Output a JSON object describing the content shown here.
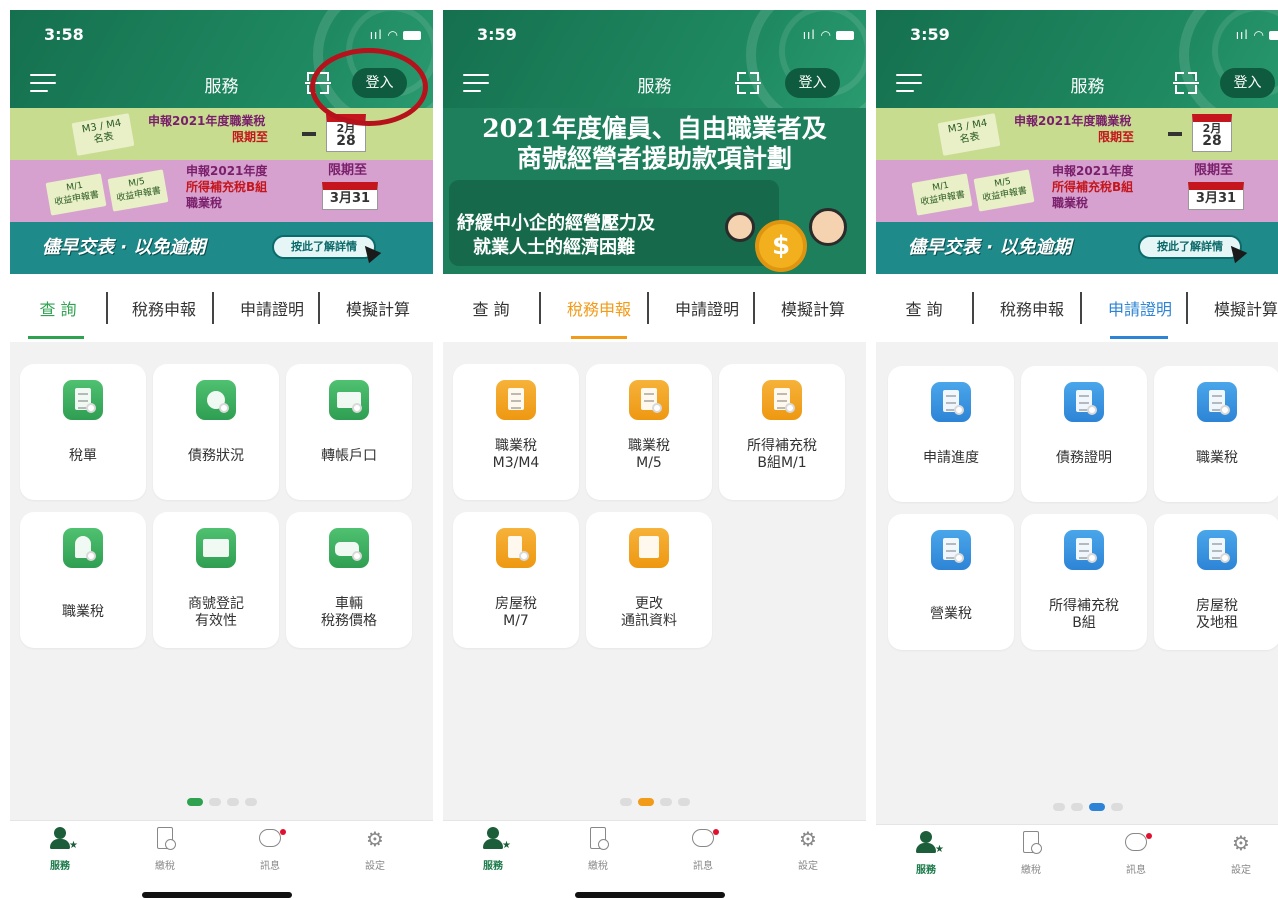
{
  "status": {
    "p1_time": "3:58",
    "p2_time": "3:59",
    "p3_time": "3:59"
  },
  "header": {
    "title": "服務",
    "login": "登入"
  },
  "banner": {
    "m34_tag": "M3 / M4\n名表",
    "b1_text1": "申報2021年度職業稅",
    "b1_text2": "限期至",
    "b1_date_month": "2月",
    "b1_date_day": "28",
    "m1_tag": "M/1\n收益申報書",
    "m5_tag": "M/5\n收益申報書",
    "b2_text1": "申報2021年度",
    "b2_text2": "所得補充稅B組",
    "b2_text3": "職業稅",
    "b2_deadline": "限期至",
    "b2_date": "3月31",
    "slogan": "儘早交表 · 以免逾期",
    "detail": "按此了解詳情"
  },
  "banner2": {
    "title_line1": "2021年度僱員、自由職業者及",
    "title_line2": "商號經營者援助款項計劃",
    "sub_line1": "紓緩中小企的經營壓力及",
    "sub_line2": "就業人士的經濟困難",
    "coin": "$"
  },
  "tabs": [
    "查 詢",
    "稅務申報",
    "申請證明",
    "模擬計算"
  ],
  "colors": {
    "green": "#2ea24f",
    "orange": "#f29b18",
    "blue": "#2d84d6",
    "header": "#15704f"
  },
  "p1_tiles": [
    "稅單",
    "債務狀況",
    "轉帳戶口",
    "職業稅",
    "商號登記\n有效性",
    "車輛\n稅務價格"
  ],
  "p2_tiles": [
    "職業稅\nM3/M4",
    "職業稅\nM/5",
    "所得補充稅\nB組M/1",
    "房屋稅\nM/7",
    "更改\n通訊資料"
  ],
  "p3_tiles": [
    "申請進度",
    "債務證明",
    "職業稅",
    "營業稅",
    "所得補充稅\nB組",
    "房屋稅\n及地租"
  ],
  "nav": [
    "服務",
    "繳稅",
    "訊息",
    "設定"
  ]
}
